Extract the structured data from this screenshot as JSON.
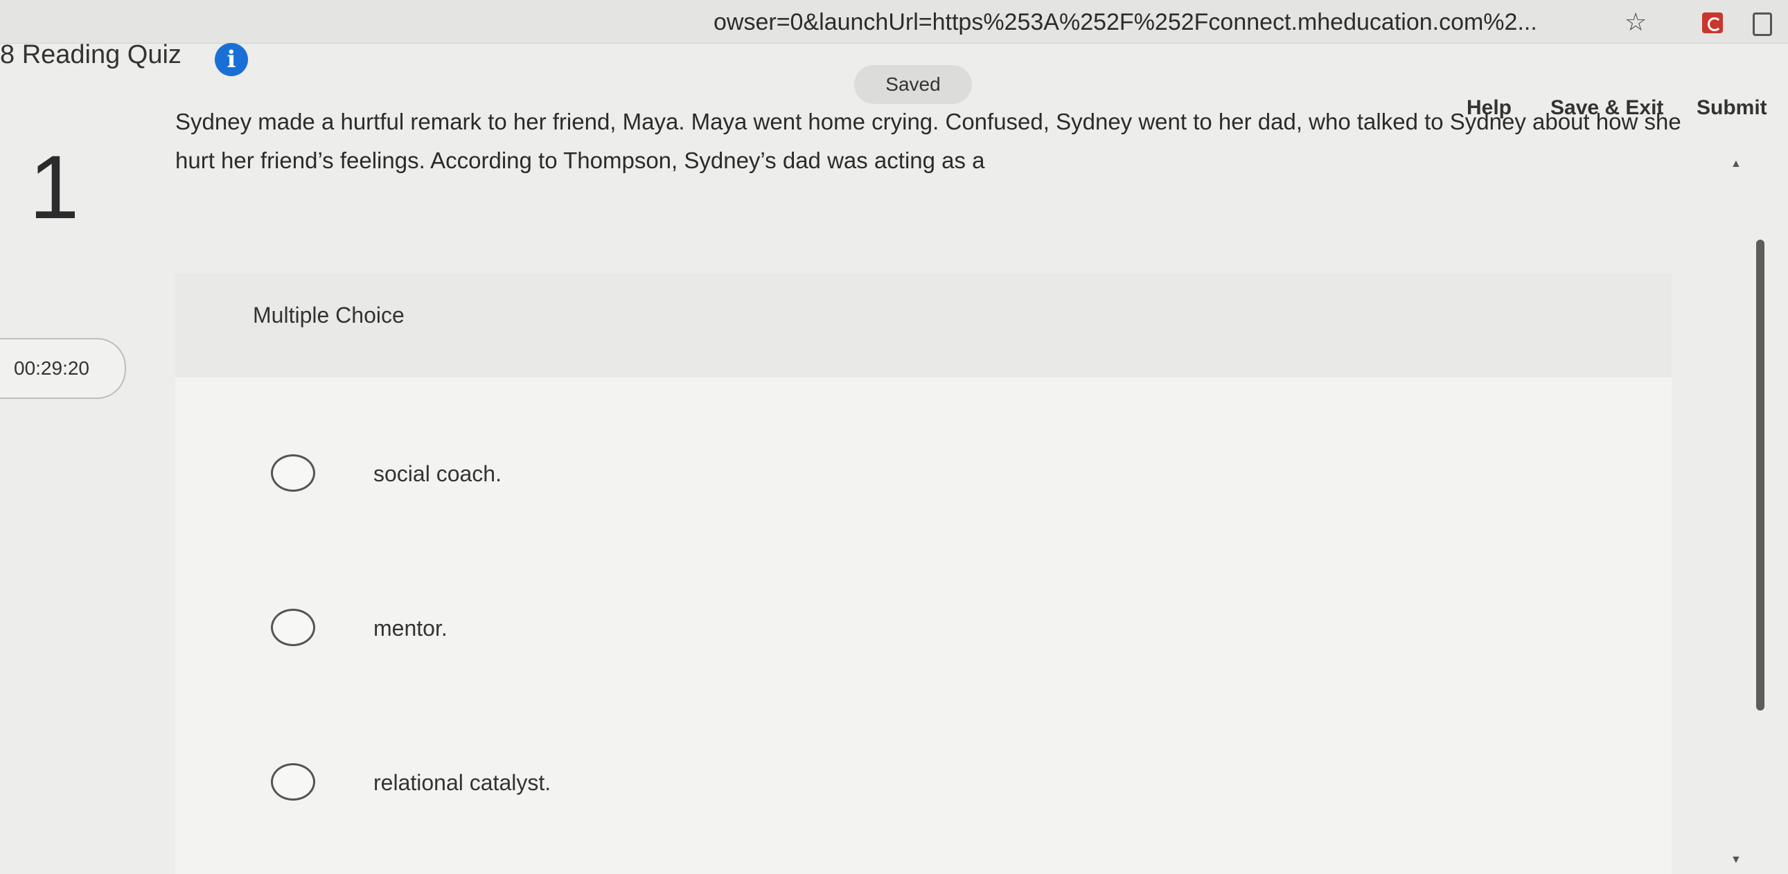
{
  "browser": {
    "url": "owser=0&launchUrl=https%253A%252F%252Fconnect.mheducation.com%2..."
  },
  "header": {
    "quiz_title": "8 Reading Quiz",
    "saved_status": "Saved",
    "help_label": "Help",
    "save_exit_label": "Save & Exit",
    "submit_label": "Submit"
  },
  "question": {
    "number": "1",
    "prompt": "Sydney made a hurtful remark to her friend, Maya. Maya went home crying. Confused, Sydney went to her dad, who talked to Sydney about how she hurt her friend’s feelings. According to Thompson, Sydney’s dad was acting as a",
    "type_label": "Multiple Choice",
    "options": [
      {
        "text": "social coach."
      },
      {
        "text": "mentor."
      },
      {
        "text": "relational catalyst."
      }
    ]
  },
  "timer": {
    "value": "00:29:20"
  },
  "colors": {
    "info_icon": "#1a6fd6",
    "pdf_icon": "#c8372d",
    "page_bg": "#ededeb"
  }
}
